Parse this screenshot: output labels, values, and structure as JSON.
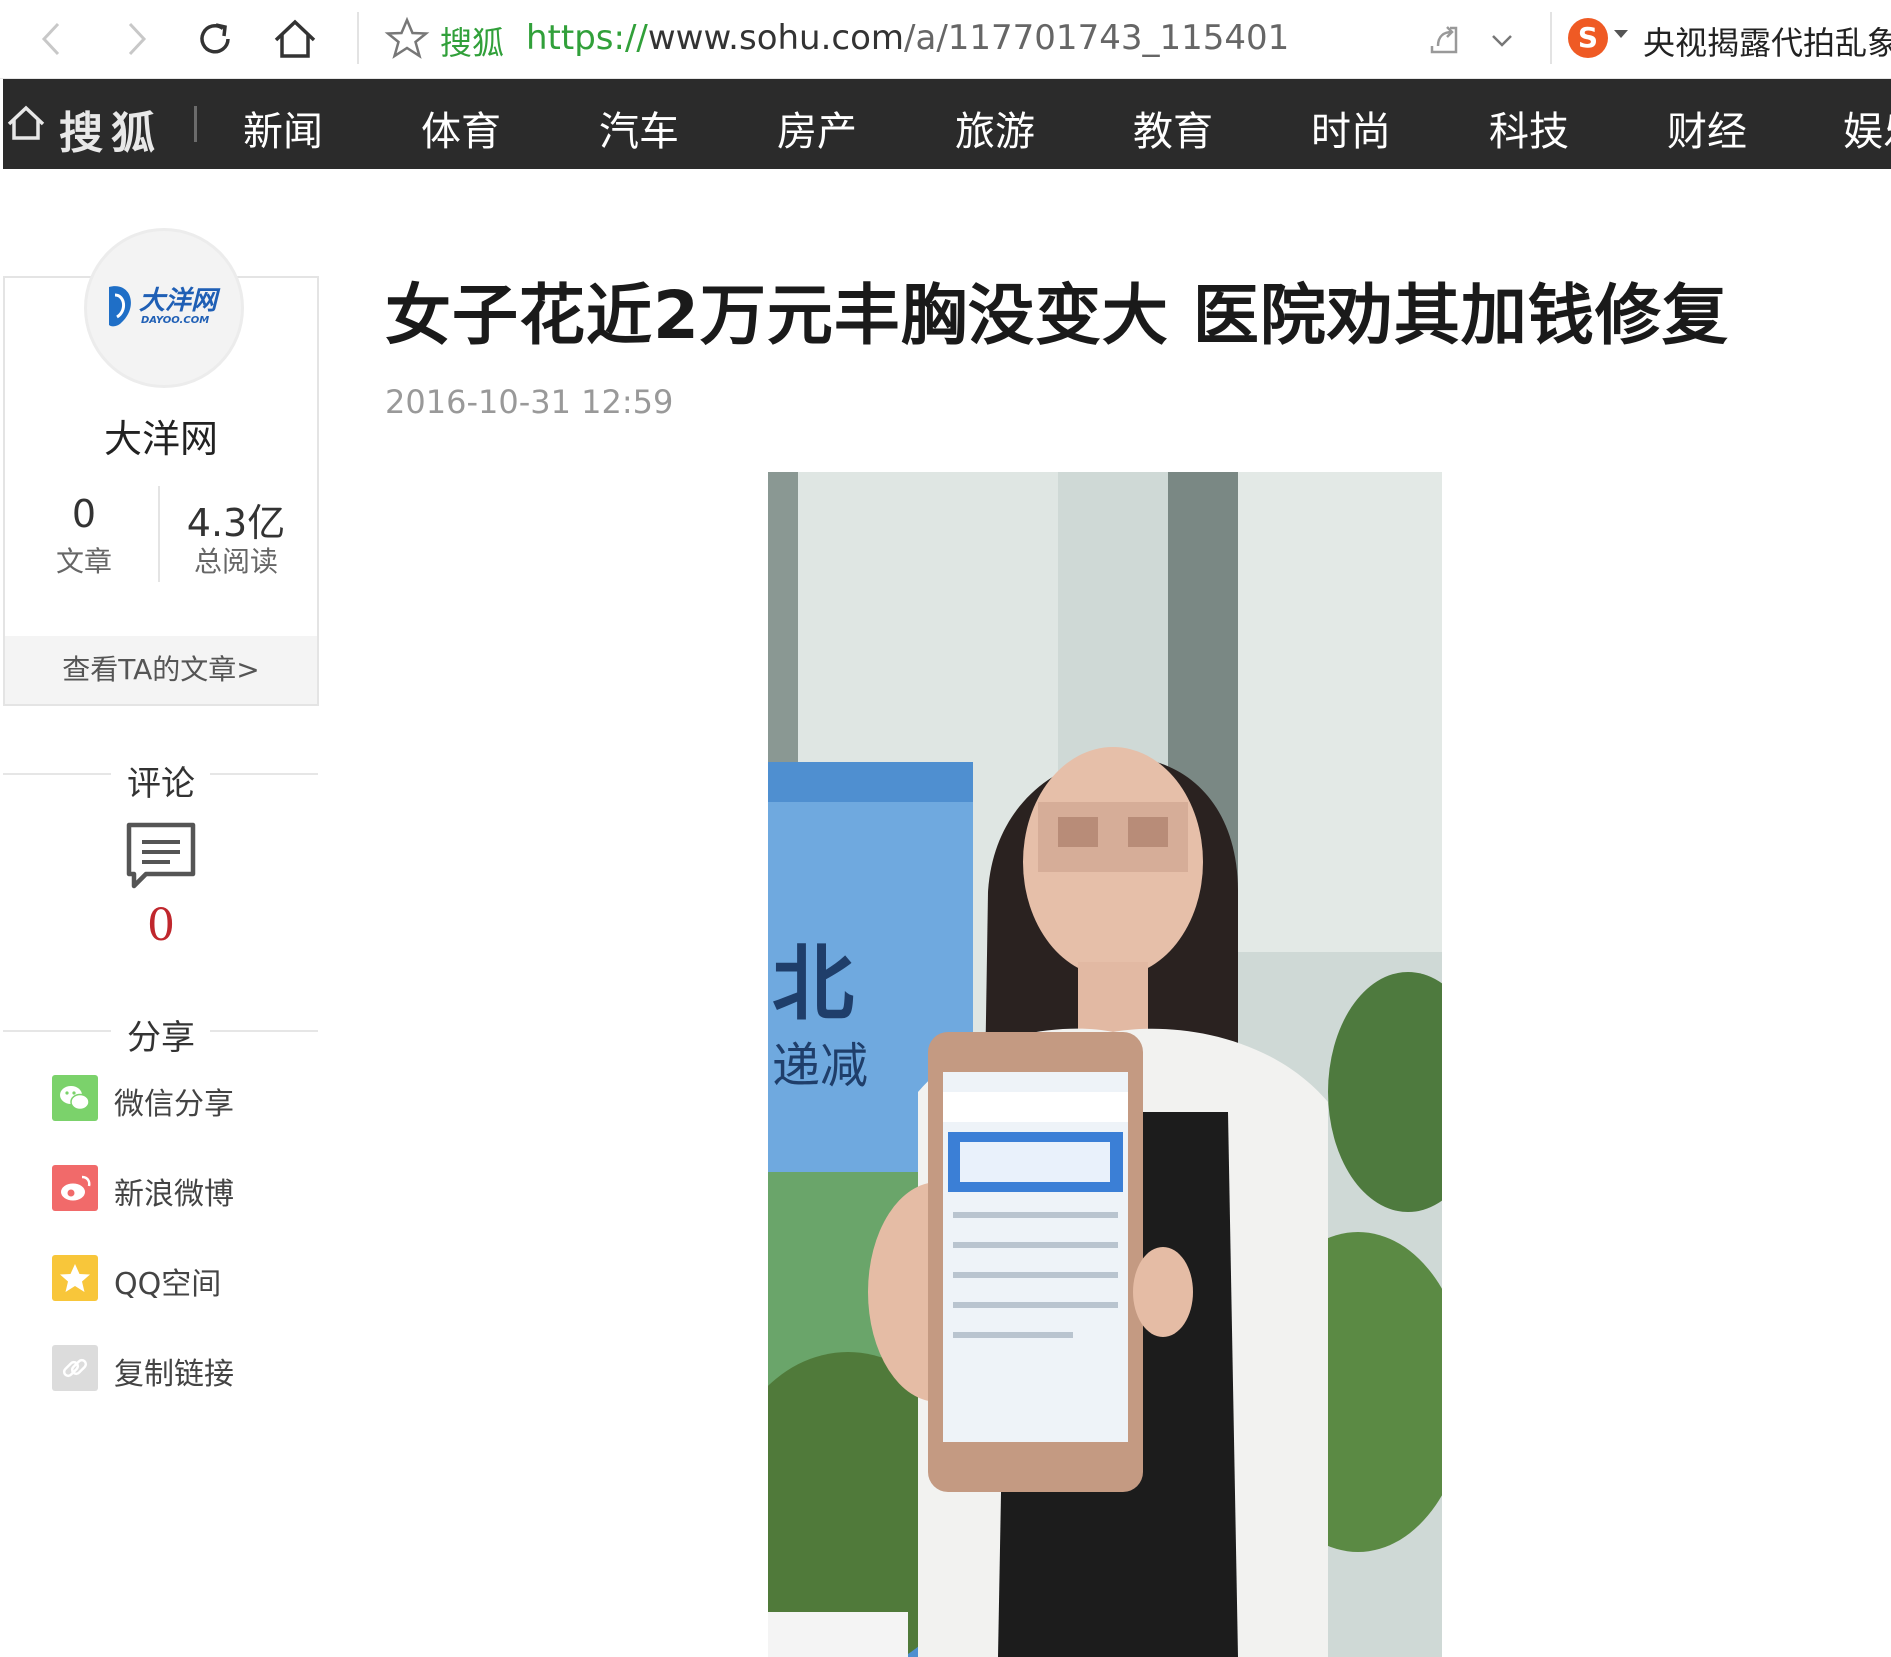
{
  "browser": {
    "site_name": "搜狐",
    "url_scheme": "https://",
    "url_host": "www.sohu.com",
    "url_path": "/a/117701743_115401",
    "search_hint": "央视揭露代拍乱象",
    "search_engine_icon": "sogou-icon"
  },
  "nav": {
    "logo": "搜狐",
    "items": [
      "新闻",
      "体育",
      "汽车",
      "房产",
      "旅游",
      "教育",
      "时尚",
      "科技",
      "财经",
      "娱乐"
    ]
  },
  "author": {
    "avatar_text": "大洋网",
    "avatar_sub": "DAYOO.COM",
    "name": "大洋网",
    "articles_count": "0",
    "articles_label": "文章",
    "reads_count": "4.3亿",
    "reads_label": "总阅读",
    "view_link": "查看TA的文章>"
  },
  "comments": {
    "title": "评论",
    "count": "0"
  },
  "share": {
    "title": "分享",
    "items": [
      {
        "label": "微信分享",
        "icon": "wechat-icon",
        "color": "#7bd26b"
      },
      {
        "label": "新浪微博",
        "icon": "weibo-icon",
        "color": "#f16a6a"
      },
      {
        "label": "QQ空间",
        "icon": "qzone-icon",
        "color": "#f8c63a"
      },
      {
        "label": "复制链接",
        "icon": "link-icon",
        "color": "#dcdcdc"
      }
    ]
  },
  "article": {
    "title": "女子花近2万元丰胸没变大 医院劝其加钱修复",
    "date": "2016-10-31 12:59"
  },
  "colors": {
    "nav_bg": "#2b2b2b",
    "url_green": "#31a03a",
    "comment_red": "#c0272d"
  }
}
